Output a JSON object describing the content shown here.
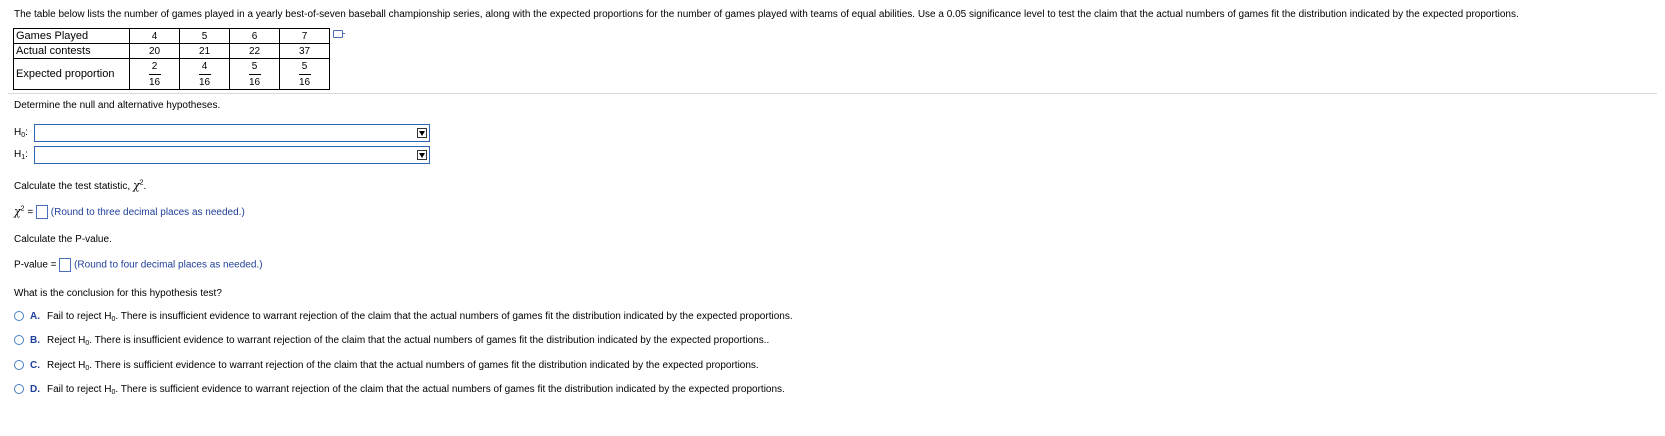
{
  "intro": "The table below lists the number of games played in a yearly best-of-seven baseball championship series, along with the expected proportions for the number of games played with teams of equal abilities. Use a 0.05 significance level to test the claim that the actual numbers of games fit the distribution indicated by the expected proportions.",
  "table": {
    "row_labels": [
      "Games Played",
      "Actual contests",
      "Expected proportion"
    ],
    "games_played": [
      "4",
      "5",
      "6",
      "7"
    ],
    "actual": [
      "20",
      "21",
      "22",
      "37"
    ],
    "expected_num": [
      "2",
      "4",
      "5",
      "5"
    ],
    "expected_den": [
      "16",
      "16",
      "16",
      "16"
    ]
  },
  "hypotheses": {
    "prompt": "Determine the null and alternative hypotheses.",
    "h0_letter": "H",
    "h0_sub": "0",
    "h1_letter": "H",
    "h1_sub": "1",
    "colon": ":",
    "h0_selected": "",
    "h1_selected": ""
  },
  "test_statistic": {
    "prompt": "Calculate the test statistic, ",
    "chi": "χ",
    "sq": "2",
    "period": ".",
    "eq": " =",
    "value": "",
    "hint": "(Round to three decimal places as needed.)"
  },
  "p_value": {
    "prompt": "Calculate the P-value.",
    "label": "P-value =",
    "value": "",
    "hint": "(Round to four decimal places as needed.)"
  },
  "conclusion": {
    "prompt": "What is the conclusion for this hypothesis test?",
    "options": [
      {
        "letter": "A.",
        "pre": "Fail to reject H",
        "sub": "0",
        "post": ". There is insufficient evidence to warrant rejection of the claim that the actual numbers of games fit the distribution indicated by the expected proportions."
      },
      {
        "letter": "B.",
        "pre": "Reject H",
        "sub": "0",
        "post": ". There is insufficient evidence to warrant rejection of the claim that the actual numbers of games fit the distribution indicated by the expected proportions.."
      },
      {
        "letter": "C.",
        "pre": "Reject H",
        "sub": "0",
        "post": ". There is sufficient evidence to warrant rejection of the claim that the actual numbers of games fit the distribution indicated by the expected proportions."
      },
      {
        "letter": "D.",
        "pre": "Fail to reject H",
        "sub": "0",
        "post": ". There is sufficient evidence to warrant rejection of the claim that the actual numbers of games fit the distribution indicated by the expected proportions."
      }
    ]
  },
  "colors": {
    "accent": "#1f3f9a",
    "input_border": "#2f63b5"
  }
}
